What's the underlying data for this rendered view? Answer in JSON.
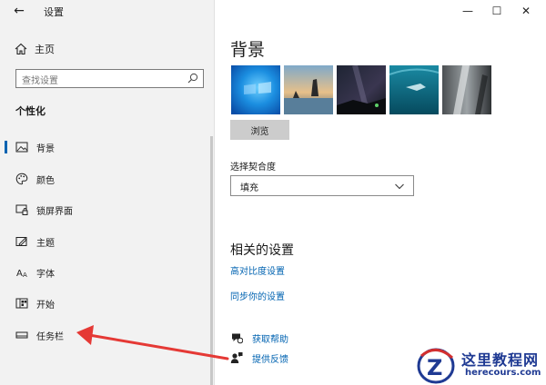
{
  "window": {
    "title": "设置",
    "back_glyph": "←",
    "minimize_glyph": "—",
    "maximize_glyph": "☐",
    "close_glyph": "✕"
  },
  "sidebar": {
    "home_label": "主页",
    "search_placeholder": "查找设置",
    "section_heading": "个性化",
    "items": [
      {
        "label": "背景",
        "icon": "picture-icon",
        "active": true
      },
      {
        "label": "颜色",
        "icon": "palette-icon",
        "active": false
      },
      {
        "label": "锁屏界面",
        "icon": "lock-screen-icon",
        "active": false
      },
      {
        "label": "主题",
        "icon": "theme-brush-icon",
        "active": false
      },
      {
        "label": "字体",
        "icon": "font-icon",
        "active": false
      },
      {
        "label": "开始",
        "icon": "start-menu-icon",
        "active": false
      },
      {
        "label": "任务栏",
        "icon": "taskbar-icon",
        "active": false
      }
    ]
  },
  "main": {
    "title": "背景",
    "browse_label": "浏览",
    "fit_label": "选择契合度",
    "fit_value": "填充",
    "related_heading": "相关的设置",
    "links": [
      "高对比度设置",
      "同步你的设置"
    ],
    "help_items": [
      {
        "label": "获取帮助",
        "icon": "help-chat-icon"
      },
      {
        "label": "提供反馈",
        "icon": "feedback-person-icon"
      }
    ]
  },
  "colors": {
    "accent": "#0063b1",
    "annotation_arrow": "#e53935"
  },
  "watermark": {
    "cn": "这里教程网",
    "en": "herecours.com"
  }
}
